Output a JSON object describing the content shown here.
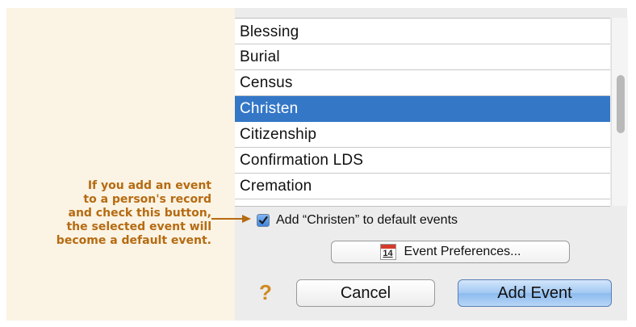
{
  "list": {
    "items": [
      {
        "label": "Blessing",
        "selected": false
      },
      {
        "label": "Burial",
        "selected": false
      },
      {
        "label": "Census",
        "selected": false
      },
      {
        "label": "Christen",
        "selected": true
      },
      {
        "label": "Citizenship",
        "selected": false
      },
      {
        "label": "Confirmation LDS",
        "selected": false
      },
      {
        "label": "Cremation",
        "selected": false
      }
    ]
  },
  "default_checkbox": {
    "checked": true,
    "label": "Add “Christen” to default events"
  },
  "event_preferences": {
    "icon": "calendar-icon",
    "icon_number": "14",
    "label": "Event Preferences..."
  },
  "help": {
    "icon": "help-icon",
    "glyph": "?"
  },
  "buttons": {
    "cancel_label": "Cancel",
    "add_label": "Add Event"
  },
  "callout": {
    "lines": [
      "If you add an event",
      "to a person's record",
      "and check this button,",
      "the selected event will",
      "become a default event."
    ]
  },
  "colors": {
    "selection": "#3477c7",
    "callout_text": "#b56b12",
    "callout_background": "#fbf3e3",
    "default_button": "#a2c8f2",
    "help_icon": "#cf8a1f"
  }
}
